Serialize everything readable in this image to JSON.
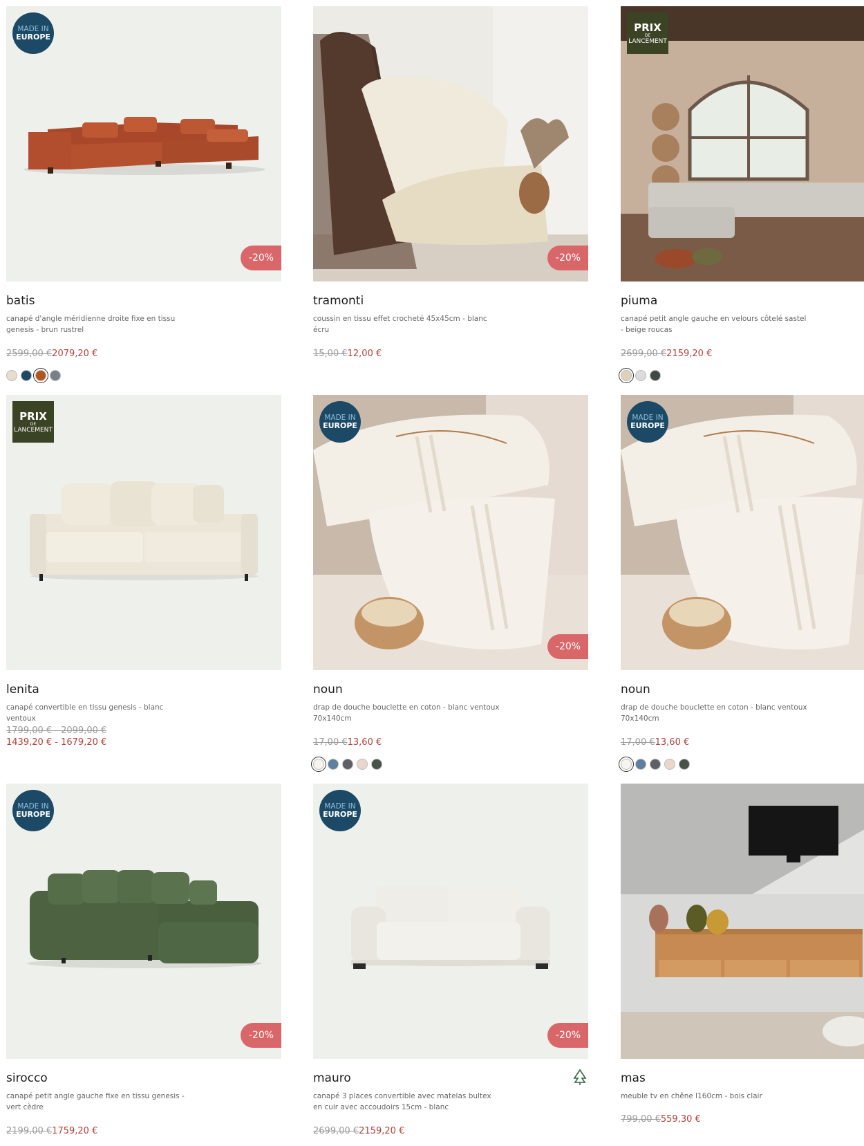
{
  "products": [
    {
      "name": "batis",
      "description": "canapé d'angle méridienne droite fixe en tissu genesis - brun rustrel",
      "old_price": "2599,00 €",
      "new_price": "2079,20 €",
      "badge": "MADE IN EUROPE",
      "discount": "-20%",
      "swatches": [
        "#e7dccd",
        "#1c4a66",
        "#b3541e",
        "#7a8088"
      ]
    },
    {
      "name": "tramonti",
      "description": "coussin en tissu effet crocheté 45x45cm - blanc écru",
      "old_price": "15,00 €",
      "new_price": "12,00 €",
      "discount": "-20%"
    },
    {
      "name": "piuma",
      "description": "canapé petit angle gauche en velours côtelé sastel - beige roucas",
      "old_price": "2699,00 €",
      "new_price": "2159,20 €",
      "badge": "PRIX DE LANCEMENT",
      "swatches": [
        "#e0d1b9",
        "#dcdcdc",
        "#404a42"
      ]
    },
    {
      "name": "lenita",
      "description": "canapé convertible en tissu genesis - blanc ventoux",
      "old_price": "1799,00 € - 2099,00 €",
      "new_price": "1439,20 € - 1679,20 €",
      "badge": "PRIX DE LANCEMENT"
    },
    {
      "name": "noun",
      "description": "drap de douche bouclette en coton - blanc ventoux 70x140cm",
      "old_price": "17,00 €",
      "new_price": "13,60 €",
      "badge": "MADE IN EUROPE",
      "discount": "-20%",
      "swatches": [
        "#f6f4ee",
        "#5d7fa0",
        "#5e6064",
        "#ead6cb",
        "#49524a"
      ]
    },
    {
      "name": "noun",
      "description": "drap de douche bouclette en coton - blanc ventoux 70x140cm",
      "old_price": "17,00 €",
      "new_price": "13,60 €",
      "badge": "MADE IN EUROPE",
      "swatches": [
        "#f6f4ee",
        "#5d7fa0",
        "#5e6064",
        "#ead6cb",
        "#49524a"
      ]
    },
    {
      "name": "sirocco",
      "description": "canapé petit angle gauche fixe en tissu genesis - vert cèdre",
      "old_price": "2199,00 €",
      "new_price": "1759,20 €",
      "badge": "MADE IN EUROPE",
      "discount": "-20%"
    },
    {
      "name": "mauro",
      "description": "canapé 3 places convertible avec matelas bultex en cuir avec accoudoirs 15cm - blanc",
      "old_price": "2699,00 €",
      "new_price": "2159,20 €",
      "badge": "MADE IN EUROPE",
      "discount": "-20%",
      "fsc_icon": "fsc-tree-icon"
    },
    {
      "name": "mas",
      "description": "meuble tv en chêne l160cm - bois clair",
      "old_price": "799,00 €",
      "new_price": "559,30 €"
    }
  ],
  "badges": {
    "eu_line1": "MADE IN",
    "eu_line2": "EUROPE",
    "prix_line1": "PRIX",
    "prix_line2": "DE",
    "prix_line3": "LANCEMENT"
  },
  "colors": {
    "price_red": "#b3413a",
    "discount_bg": "#d9676a",
    "eu_badge_bg": "#1c4a66",
    "prix_badge_bg": "#3a4324"
  }
}
